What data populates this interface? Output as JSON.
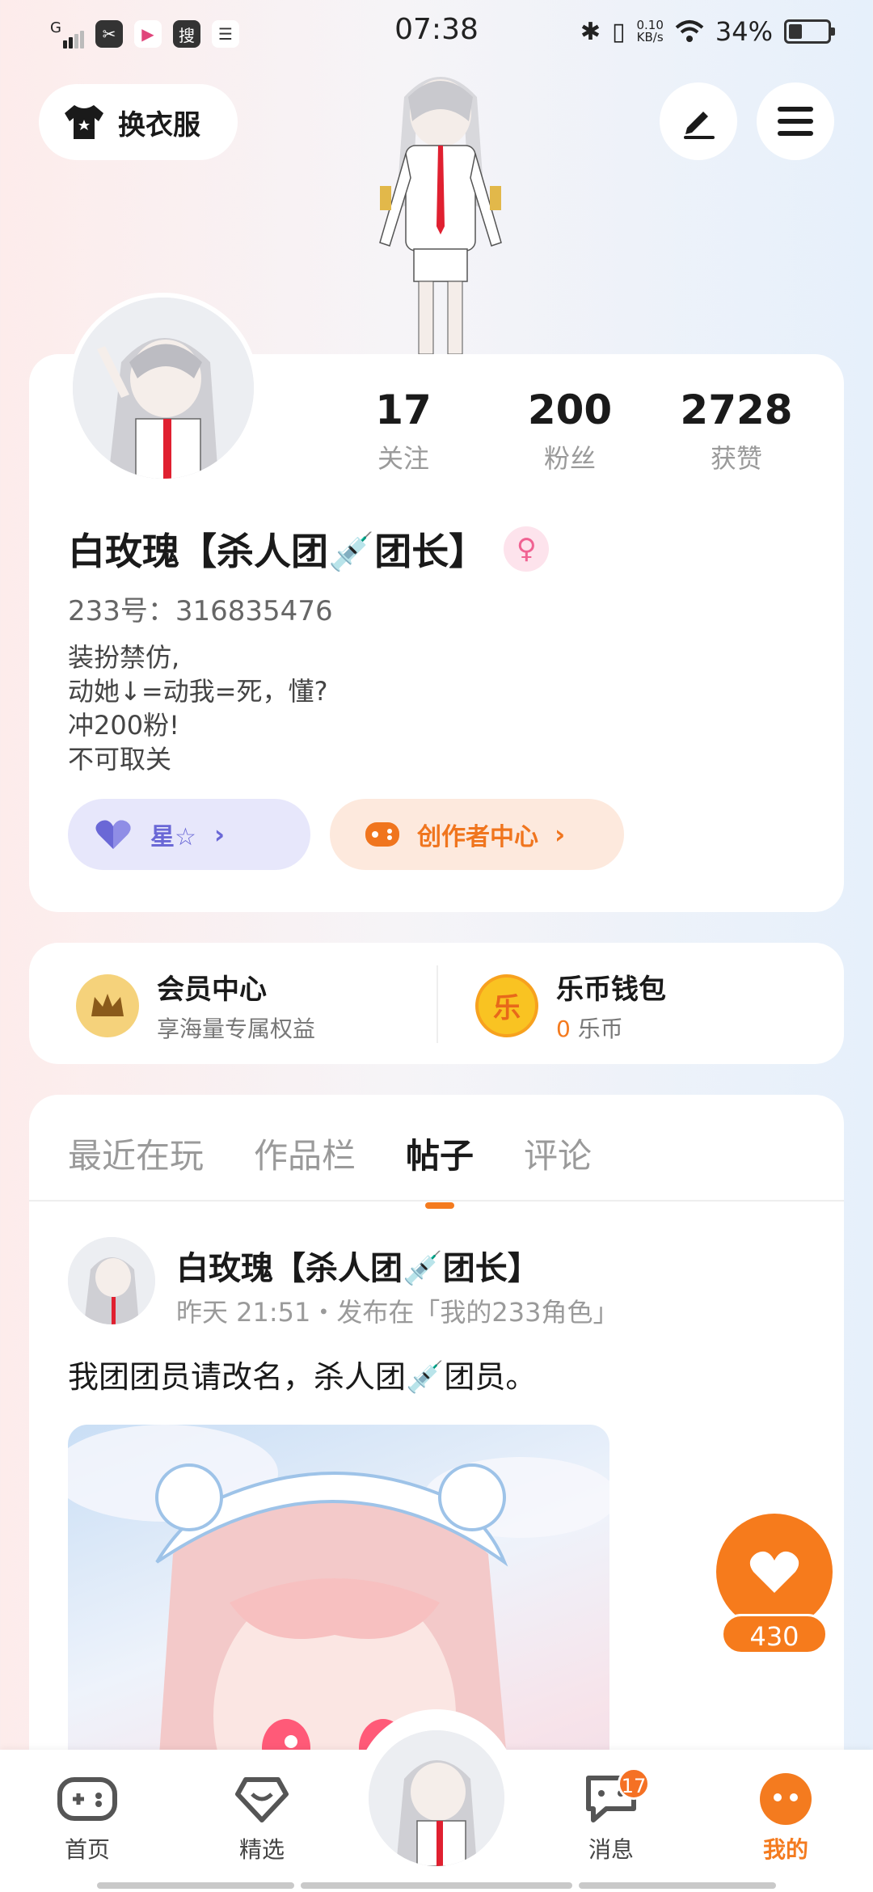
{
  "status_bar": {
    "signal": "G",
    "app_icons": [
      "✂",
      "▶",
      "搜"
    ],
    "time": "07:38",
    "net_speed_value": "0.10",
    "net_speed_unit": "KB/s",
    "battery": "34%"
  },
  "top": {
    "dress_label": "换衣服"
  },
  "profile": {
    "name": "白玫瑰【杀人团💉团长】",
    "gender": "♀",
    "uid": "233号：316835476",
    "bio": [
      "装扮禁仿,",
      "动她↓=动我=死，懂?",
      "冲200粉!",
      "不可取关"
    ],
    "stats": [
      {
        "num": "17",
        "label": "关注"
      },
      {
        "num": "200",
        "label": "粉丝"
      },
      {
        "num": "2728",
        "label": "获赞"
      }
    ],
    "star_chip": "星☆",
    "creator_chip": "创作者中心"
  },
  "vip": {
    "member_title": "会员中心",
    "member_sub": "享海量专属权益",
    "wallet_title": "乐币钱包",
    "wallet_coin_icon": "乐",
    "wallet_amount": "0",
    "wallet_unit": "乐币"
  },
  "feed": {
    "tabs": [
      "最近在玩",
      "作品栏",
      "帖子",
      "评论"
    ],
    "active_tab": "帖子",
    "post": {
      "author": "白玫瑰【杀人团💉团长】",
      "meta": "昨天 21:51・发布在「我的233角色」",
      "text": "我团团员请改名，杀人团💉团员。"
    }
  },
  "like": {
    "count": "430"
  },
  "nav": {
    "items": [
      "首页",
      "精选",
      "消息",
      "我的"
    ],
    "message_badge": "17"
  },
  "colors": {
    "accent": "#f47b1f",
    "star": "#6a68d6",
    "gender": "#f06292"
  }
}
